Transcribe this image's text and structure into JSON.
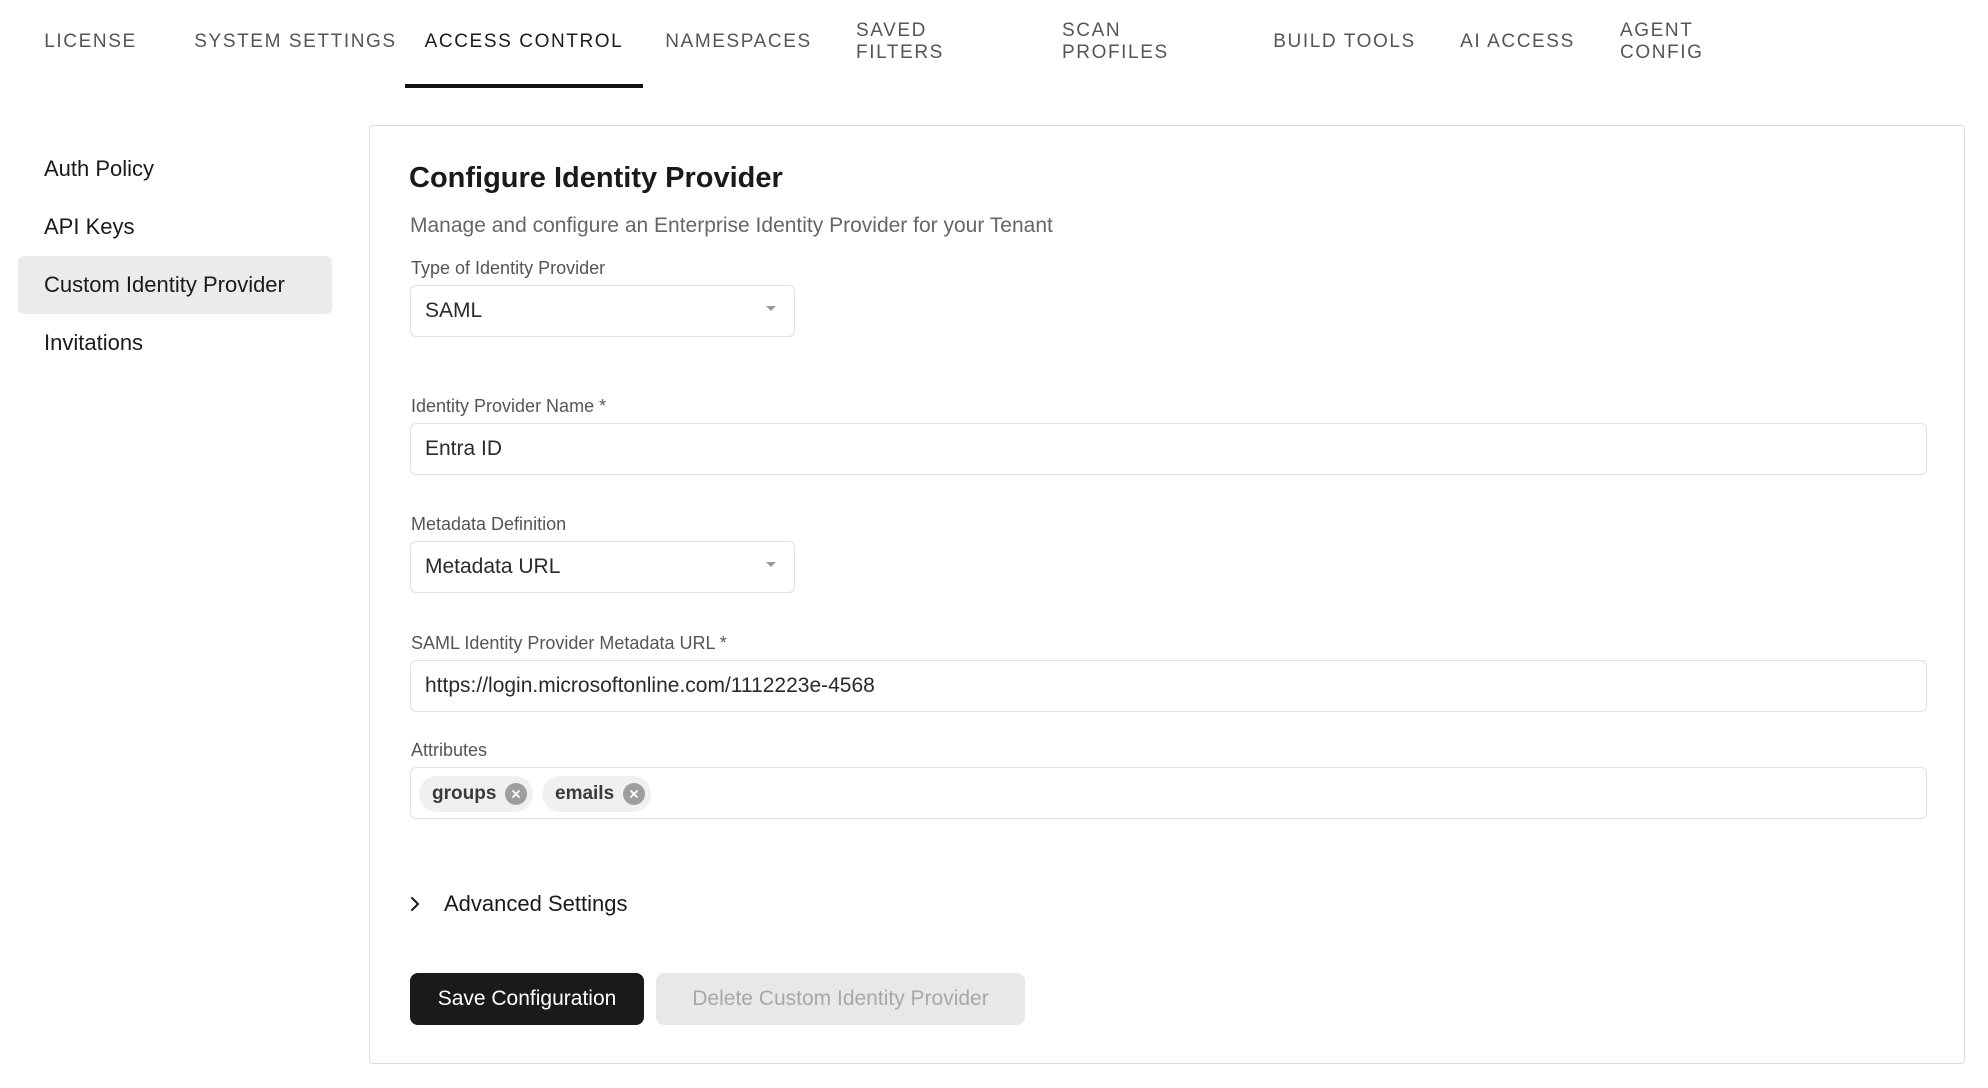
{
  "tabs": [
    {
      "label": "LICENSE",
      "active": false
    },
    {
      "label": "SYSTEM SETTINGS",
      "active": false
    },
    {
      "label": "ACCESS CONTROL",
      "active": true
    },
    {
      "label": "NAMESPACES",
      "active": false
    },
    {
      "label": "SAVED FILTERS",
      "active": false
    },
    {
      "label": "SCAN PROFILES",
      "active": false
    },
    {
      "label": "BUILD TOOLS",
      "active": false
    },
    {
      "label": "AI ACCESS",
      "active": false
    },
    {
      "label": "AGENT CONFIG",
      "active": false
    }
  ],
  "sidebar": {
    "items": [
      {
        "label": "Auth Policy",
        "active": false
      },
      {
        "label": "API Keys",
        "active": false
      },
      {
        "label": "Custom Identity Provider",
        "active": true
      },
      {
        "label": "Invitations",
        "active": false
      }
    ]
  },
  "form": {
    "title": "Configure Identity Provider",
    "subtitle": "Manage and configure an Enterprise Identity Provider for your Tenant",
    "provider_type": {
      "label": "Type of Identity Provider",
      "value": "SAML"
    },
    "provider_name": {
      "label": "Identity Provider Name *",
      "value": "Entra ID"
    },
    "metadata_definition": {
      "label": "Metadata Definition",
      "value": "Metadata URL"
    },
    "metadata_url": {
      "label": "SAML Identity Provider Metadata URL *",
      "value": "https://login.microsoftonline.com/1112223e-4568"
    },
    "attributes": {
      "label": "Attributes",
      "chips": [
        "groups",
        "emails"
      ]
    },
    "advanced_settings_label": "Advanced Settings",
    "save_button_label": "Save Configuration",
    "delete_button_label": "Delete Custom Identity Provider"
  },
  "icons": {
    "dropdown": "caret-down-icon",
    "chip_remove": "close-circle-icon",
    "expand": "chevron-right-icon"
  },
  "colors": {
    "primary_button": "#1a1a1a",
    "active_tab_underline": "#111111",
    "active_sidebar_bg": "#ebebeb",
    "disabled_button_bg": "#e8e8e8"
  }
}
